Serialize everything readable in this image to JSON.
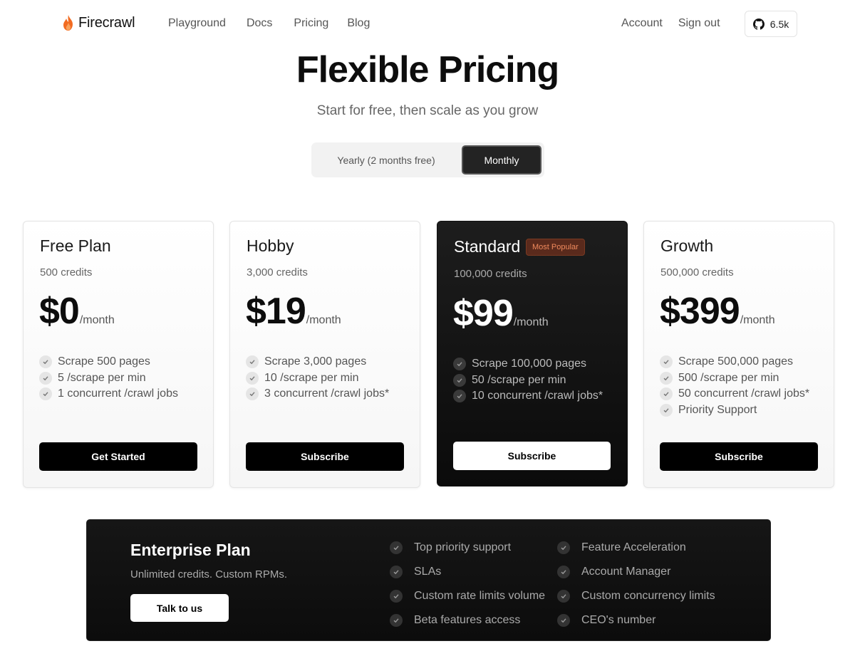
{
  "header": {
    "logo_text": "Firecrawl",
    "nav": [
      "Playground",
      "Docs",
      "Pricing",
      "Blog"
    ],
    "account": "Account",
    "sign_out": "Sign out",
    "github_stars": "6.5k"
  },
  "hero": {
    "title": "Flexible Pricing",
    "subtitle": "Start for free, then scale as you grow"
  },
  "billing_toggle": {
    "yearly": "Yearly (2 months free)",
    "monthly": "Monthly",
    "selected": "Monthly"
  },
  "plans": [
    {
      "name": "Free Plan",
      "credits": "500 credits",
      "price": "$0",
      "per": "/month",
      "features": [
        "Scrape 500 pages",
        "5 /scrape per min",
        "1 concurrent /crawl jobs"
      ],
      "button": "Get Started"
    },
    {
      "name": "Hobby",
      "credits": "3,000 credits",
      "price": "$19",
      "per": "/month",
      "features": [
        "Scrape 3,000 pages",
        "10 /scrape per min",
        "3 concurrent /crawl jobs*"
      ],
      "button": "Subscribe"
    },
    {
      "name": "Standard",
      "badge": "Most Popular",
      "credits": "100,000 credits",
      "price": "$99",
      "per": "/month",
      "features": [
        "Scrape 100,000 pages",
        "50 /scrape per min",
        "10 concurrent /crawl jobs*"
      ],
      "button": "Subscribe"
    },
    {
      "name": "Growth",
      "credits": "500,000 credits",
      "price": "$399",
      "per": "/month",
      "features": [
        "Scrape 500,000 pages",
        "500 /scrape per min",
        "50 concurrent /crawl jobs*",
        "Priority Support"
      ],
      "button": "Subscribe"
    }
  ],
  "enterprise": {
    "title": "Enterprise Plan",
    "subtitle": "Unlimited credits. Custom RPMs.",
    "button": "Talk to us",
    "features_col1": [
      "Top priority support",
      "SLAs",
      "Custom rate limits volume",
      "Beta features access"
    ],
    "features_col2": [
      "Feature Acceleration",
      "Account Manager",
      "Custom concurrency limits",
      "CEO's number"
    ]
  },
  "colors": {
    "badge_bg": "#5a2a1c",
    "badge_text": "#f08a5d",
    "flame": "#f26b21"
  }
}
